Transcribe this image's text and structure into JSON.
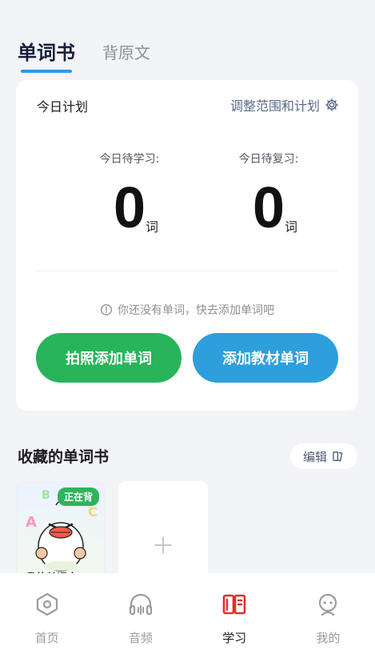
{
  "top_tabs": [
    {
      "label": "单词书",
      "active": true
    },
    {
      "label": "背原文",
      "active": false
    }
  ],
  "plan": {
    "title": "今日计划",
    "adjust_label": "调整范围和计划",
    "adjust_icon": "gear-icon",
    "to_learn_label": "今日待学习:",
    "to_learn_value": "0",
    "to_review_label": "今日待复习:",
    "to_review_value": "0",
    "unit": "词",
    "notice": "你还没有单词，快去添加单词吧",
    "notice_icon": "info-icon",
    "photo_add_button": "拍照添加单词",
    "textbook_add_button": "添加教材单词",
    "colors": {
      "green_button": "#28b45a",
      "blue_button": "#2d9fdc"
    }
  },
  "favorites": {
    "title": "收藏的单词书",
    "edit_label": "编辑",
    "edit_icon": "book-icon",
    "books": [
      {
        "title": "我的单词本",
        "badge": "正在背"
      }
    ],
    "add_icon": "plus-icon"
  },
  "bottom_nav": [
    {
      "label": "首页",
      "icon": "home-icon",
      "active": false
    },
    {
      "label": "音频",
      "icon": "headphones-icon",
      "active": false
    },
    {
      "label": "学习",
      "icon": "study-book-icon",
      "active": true
    },
    {
      "label": "我的",
      "icon": "profile-icon",
      "active": false
    }
  ],
  "accent_color": "#2d9be2",
  "active_nav_color": "#e0302a"
}
